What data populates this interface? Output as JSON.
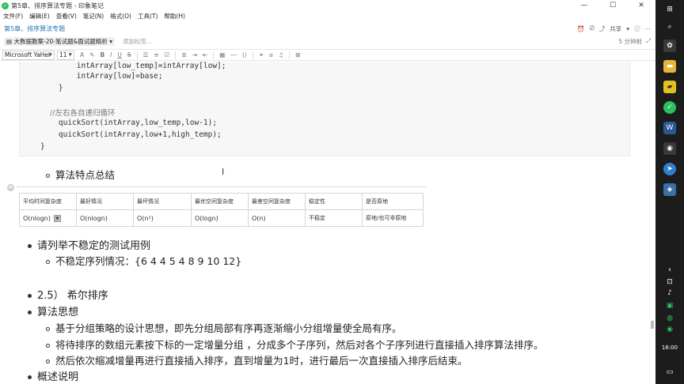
{
  "window": {
    "title": "第5章、排序算法专题 - 印象笔记",
    "controls": [
      "—",
      "☐",
      "✕"
    ]
  },
  "menu": [
    "文件(F)",
    "编辑(E)",
    "查看(V)",
    "笔记(N)",
    "格式(O)",
    "工具(T)",
    "帮助(H)"
  ],
  "note": {
    "title": "第5章、排序算法专题",
    "share_label": "共享",
    "notebook": "大数据教案-20-笔试题&面试题精析",
    "add_tag": "添加标签...",
    "saved": "5 分钟前"
  },
  "toolbar": {
    "font": "Microsoft YaHei",
    "size": "11"
  },
  "code": [
    "        intArray[low_temp]=intArray[low];",
    "        intArray[low]=base;",
    "    }",
    "",
    "    //左右各自递归循环",
    "    quickSort(intArray,low_temp,low-1);",
    "    quickSort(intArray,low+1,high_temp);",
    "}"
  ],
  "sections": {
    "algo_features": "算法特点总结",
    "unstable_example": "请列举不稳定的测试用例",
    "unstable_sequence": "不稳定序列情况：{6 4 4 5 4 8 9 10 12}",
    "shell_sort": "2.5） 希尔排序",
    "algo_idea": "算法思想",
    "idea_1": "基于分组策略的设计思想，即先分组局部有序再逐渐缩小分组增量使全局有序。",
    "idea_2": "将待排序的数组元素按下标的一定增量分组 ，分成多个子序列，然后对各个子序列进行直接插入排序算法排序。",
    "idea_3": "然后依次缩减增量再进行直接插入排序，直到增量为1时，进行最后一次直接插入排序后结束。",
    "overview": "概述说明"
  },
  "table": {
    "headers": [
      "平均时间复杂度",
      "最好情况",
      "最坏情况",
      "最优空间复杂度",
      "最差空间复杂度",
      "稳定性",
      "是否原地"
    ],
    "row": [
      "O(nlogn)",
      "O(nlogn)",
      "O(n²)",
      "O(logn)",
      "O(n)",
      "不稳定",
      "原地/也可非原地"
    ]
  },
  "taskbar": {
    "time": "16:00"
  }
}
